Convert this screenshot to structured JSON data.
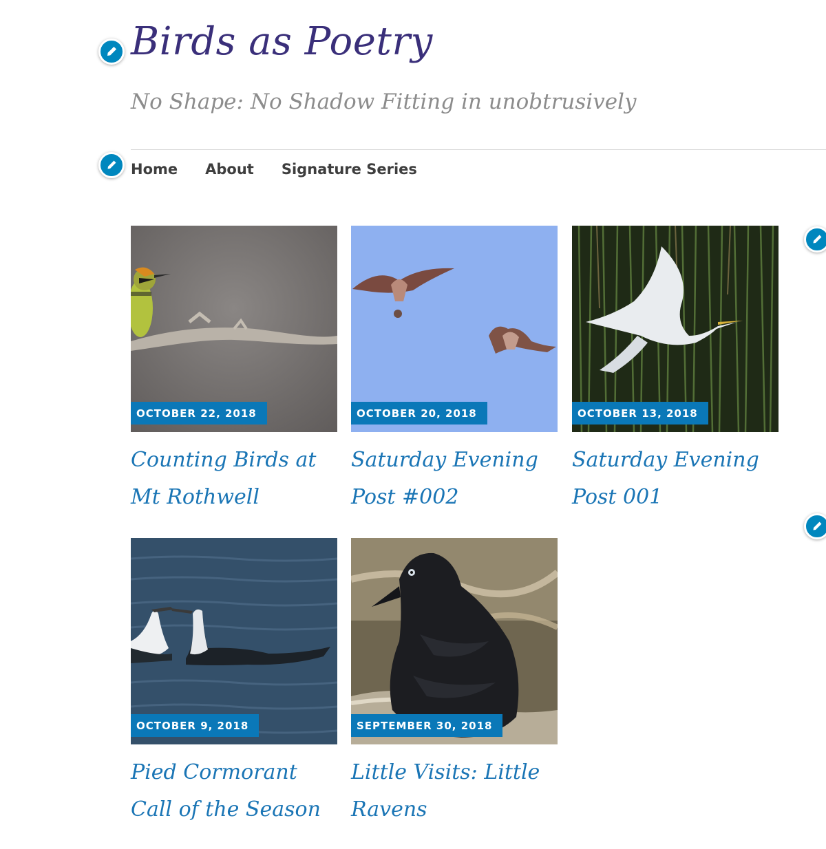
{
  "site": {
    "title": "Birds as Poetry",
    "tagline": "No Shape: No Shadow Fitting in unobtrusively"
  },
  "nav": {
    "items": [
      {
        "label": "Home"
      },
      {
        "label": "About"
      },
      {
        "label": "Signature Series"
      }
    ]
  },
  "posts": [
    {
      "date": "OCTOBER 22, 2018",
      "title": "Counting Birds at Mt Rothwell",
      "image": "rainbow-bee-eater-on-branch"
    },
    {
      "date": "OCTOBER 20, 2018",
      "title": "Saturday Evening Post #002",
      "image": "two-kites-in-flight"
    },
    {
      "date": "OCTOBER 13, 2018",
      "title": "Saturday Evening Post 001",
      "image": "egret-taking-off-reeds"
    },
    {
      "date": "OCTOBER 9, 2018",
      "title": "Pied Cormorant Call of the Season",
      "image": "pied-cormorants-on-water"
    },
    {
      "date": "SEPTEMBER 30, 2018",
      "title": "Little Visits: Little Ravens",
      "image": "little-raven-perched"
    }
  ],
  "colors": {
    "accent": "#0a78b8",
    "title": "#3a2f7a",
    "tagline": "#8c8c8c",
    "post_title": "#1a75b5",
    "edit_button": "#0087be"
  },
  "icons": {
    "edit": "pencil-icon"
  }
}
